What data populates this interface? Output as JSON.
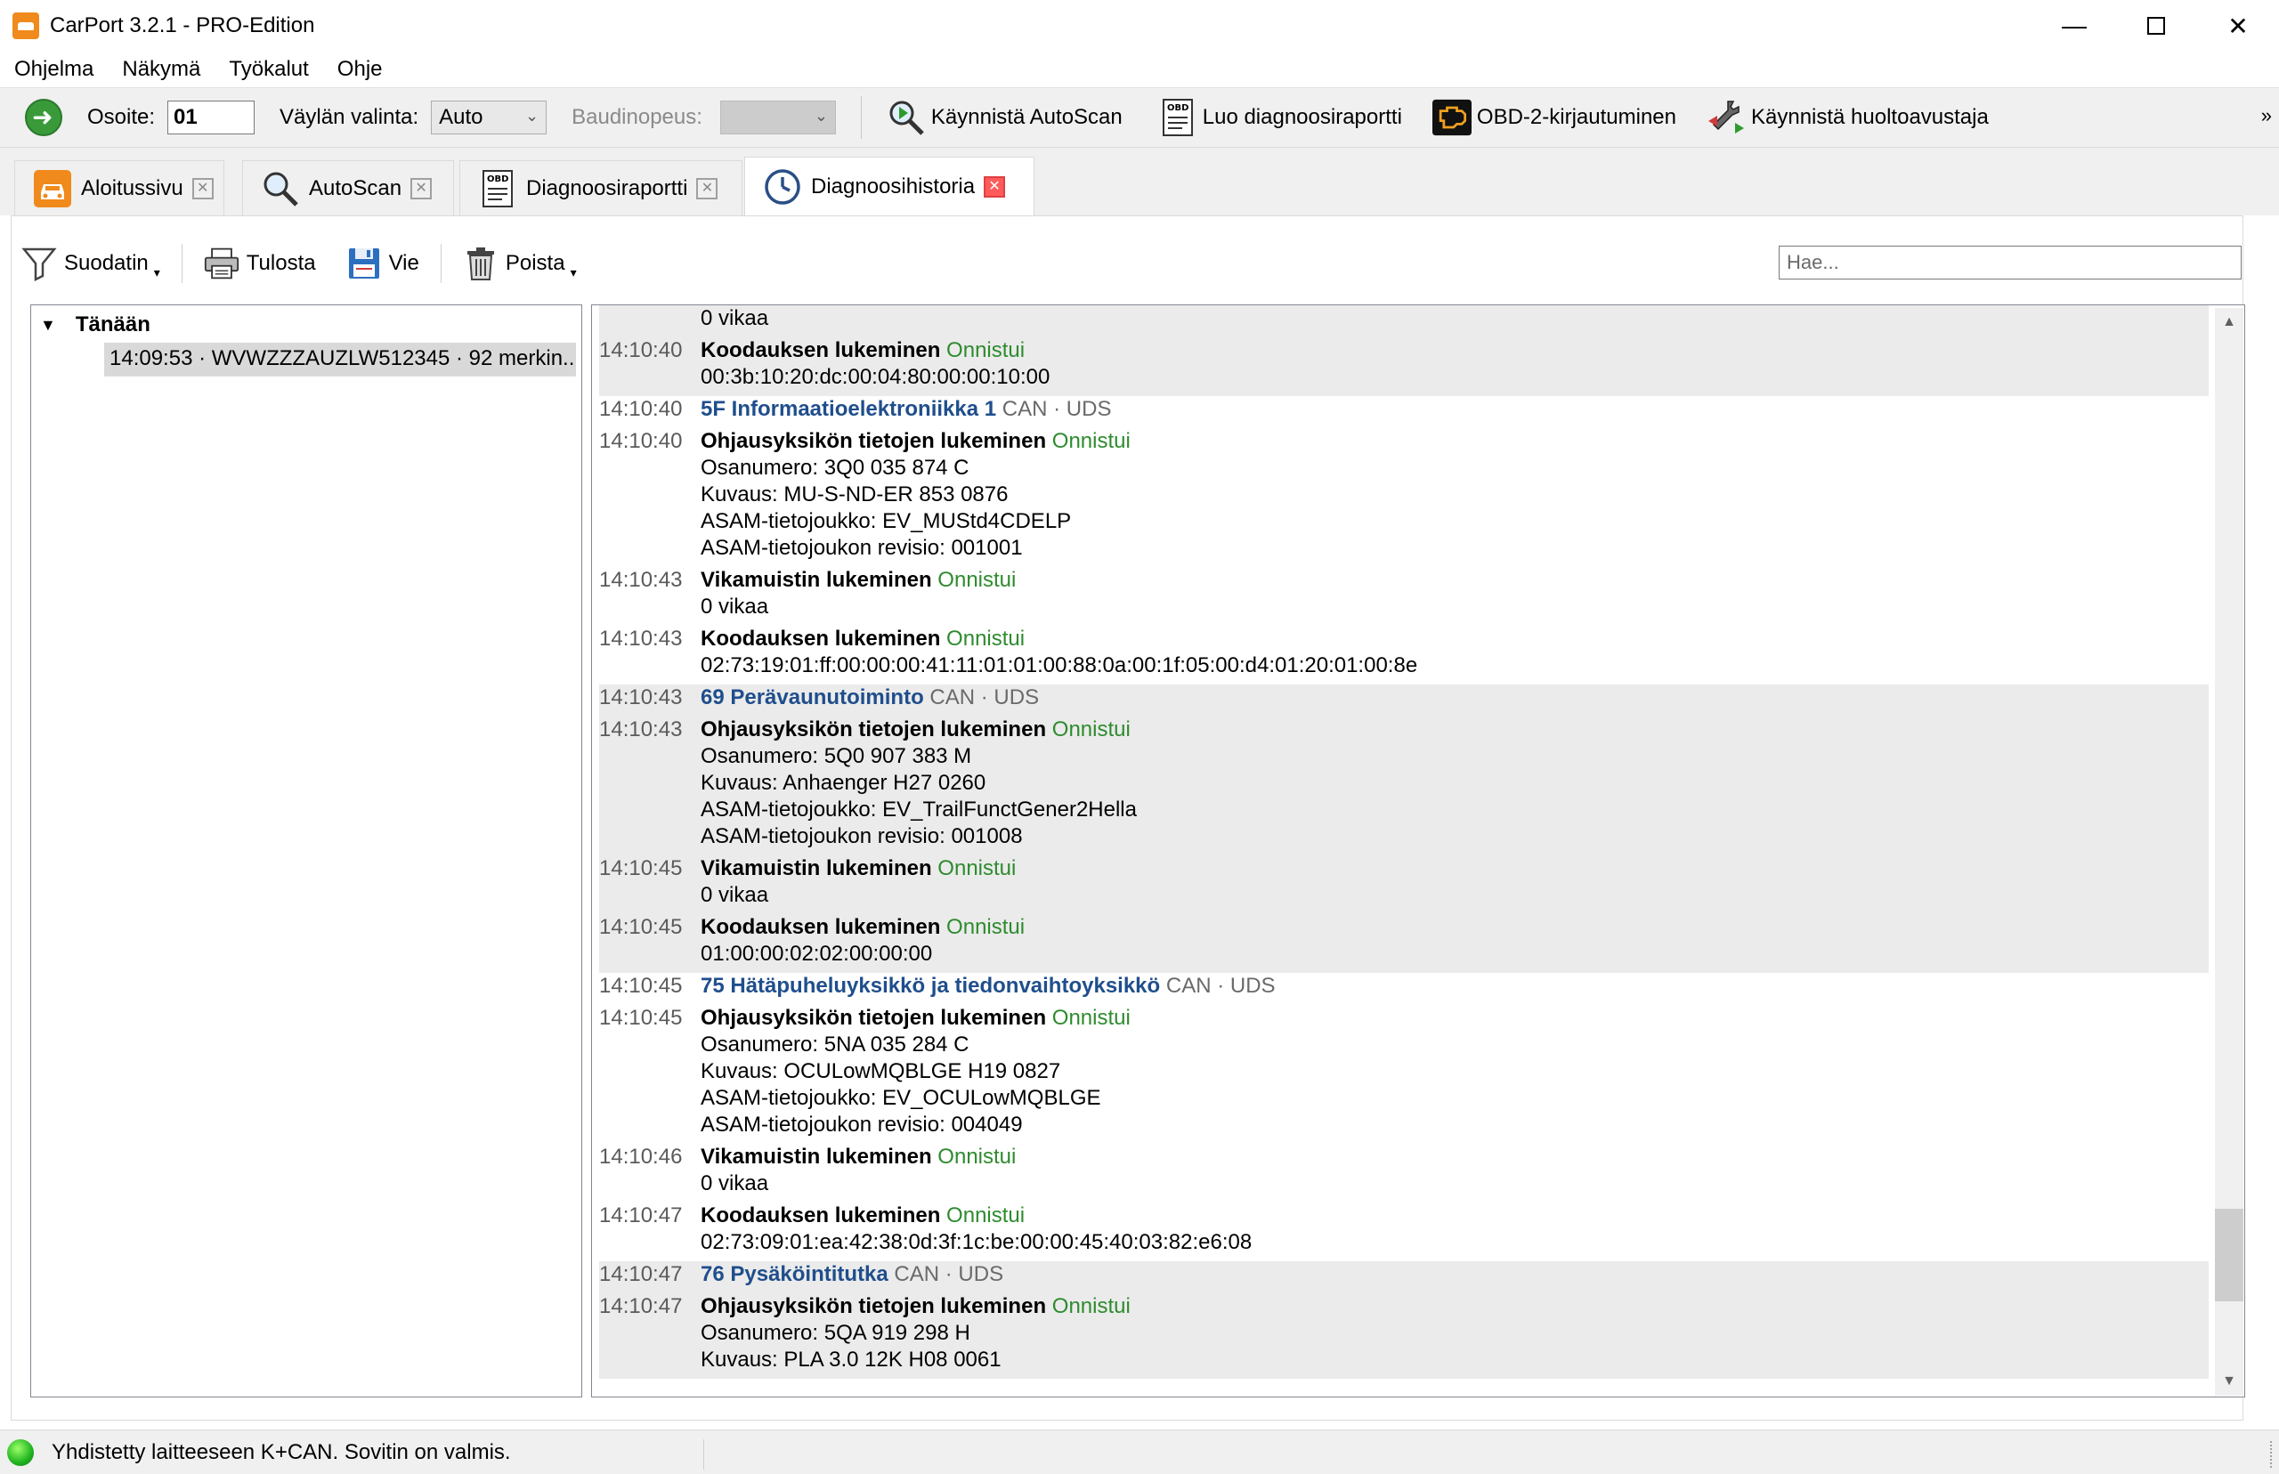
{
  "window": {
    "title": "CarPort 3.2.1 - PRO-Edition",
    "minimize": "—",
    "close": "✕"
  },
  "menu": [
    "Ohjelma",
    "Näkymä",
    "Työkalut",
    "Ohje"
  ],
  "toolbar": {
    "address_label": "Osoite:",
    "address_value": "01",
    "bus_label": "Väylän valinta:",
    "bus_value": "Auto",
    "baud_label": "Baudinopeus:",
    "baud_value": "",
    "autoscan": "Käynnistä AutoScan",
    "report": "Luo diagnoosiraportti",
    "obd_login": "OBD-2-kirjautuminen",
    "service": "Käynnistä huoltoavustaja",
    "overflow": "»"
  },
  "tabs": [
    {
      "label": "Aloitussivu"
    },
    {
      "label": "AutoScan"
    },
    {
      "label": "Diagnoosiraportti"
    },
    {
      "label": "Diagnoosihistoria"
    }
  ],
  "subtoolbar": {
    "filter": "Suodatin",
    "print": "Tulosta",
    "export": "Vie",
    "delete": "Poista",
    "search_placeholder": "Hae..."
  },
  "tree": {
    "group": "Tänään",
    "item": "14:09:53 · WVWZZZAUZLW512345 · 92 merkin..."
  },
  "log_blocks": [
    {
      "shade": true,
      "rows": [
        {
          "time": "",
          "parts": [
            {
              "t": "0 vikaa",
              "c": ""
            }
          ]
        },
        {
          "time": "14:10:40",
          "parts": [
            {
              "t": "Koodauksen lukeminen",
              "c": "b"
            },
            {
              "t": " Onnistui",
              "c": "ok"
            }
          ]
        },
        {
          "time": "",
          "parts": [
            {
              "t": "00:3b:10:20:dc:00:04:80:00:00:10:00",
              "c": ""
            }
          ]
        }
      ]
    },
    {
      "shade": false,
      "rows": [
        {
          "time": "14:10:40",
          "parts": [
            {
              "t": "5F Informaatioelektroniikka 1",
              "c": "mod"
            },
            {
              "t": "  CAN · UDS",
              "c": "proto"
            }
          ]
        },
        {
          "time": "14:10:40",
          "parts": [
            {
              "t": "Ohjausyksikön tietojen lukeminen",
              "c": "b"
            },
            {
              "t": " Onnistui",
              "c": "ok"
            }
          ]
        },
        {
          "time": "",
          "parts": [
            {
              "t": "Osanumero: 3Q0 035 874 C",
              "c": ""
            }
          ]
        },
        {
          "time": "",
          "parts": [
            {
              "t": "Kuvaus: MU-S-ND-ER 853 0876",
              "c": ""
            }
          ]
        },
        {
          "time": "",
          "parts": [
            {
              "t": "ASAM-tietojoukko: EV_MUStd4CDELP",
              "c": ""
            }
          ]
        },
        {
          "time": "",
          "parts": [
            {
              "t": "ASAM-tietojoukon revisio: 001001",
              "c": ""
            }
          ]
        },
        {
          "time": "14:10:43",
          "parts": [
            {
              "t": "Vikamuistin lukeminen",
              "c": "b"
            },
            {
              "t": " Onnistui",
              "c": "ok"
            }
          ]
        },
        {
          "time": "",
          "parts": [
            {
              "t": "0 vikaa",
              "c": ""
            }
          ]
        },
        {
          "time": "14:10:43",
          "parts": [
            {
              "t": "Koodauksen lukeminen",
              "c": "b"
            },
            {
              "t": " Onnistui",
              "c": "ok"
            }
          ]
        },
        {
          "time": "",
          "parts": [
            {
              "t": "02:73:19:01:ff:00:00:00:41:11:01:01:00:88:0a:00:1f:05:00:d4:01:20:01:00:8e",
              "c": ""
            }
          ]
        }
      ]
    },
    {
      "shade": true,
      "rows": [
        {
          "time": "14:10:43",
          "parts": [
            {
              "t": "69 Perävaunutoiminto",
              "c": "mod"
            },
            {
              "t": "  CAN · UDS",
              "c": "proto"
            }
          ]
        },
        {
          "time": "14:10:43",
          "parts": [
            {
              "t": "Ohjausyksikön tietojen lukeminen",
              "c": "b"
            },
            {
              "t": " Onnistui",
              "c": "ok"
            }
          ]
        },
        {
          "time": "",
          "parts": [
            {
              "t": "Osanumero: 5Q0 907 383 M",
              "c": ""
            }
          ]
        },
        {
          "time": "",
          "parts": [
            {
              "t": "Kuvaus: Anhaenger H27 0260",
              "c": ""
            }
          ]
        },
        {
          "time": "",
          "parts": [
            {
              "t": "ASAM-tietojoukko: EV_TrailFunctGener2Hella",
              "c": ""
            }
          ]
        },
        {
          "time": "",
          "parts": [
            {
              "t": "ASAM-tietojoukon revisio: 001008",
              "c": ""
            }
          ]
        },
        {
          "time": "14:10:45",
          "parts": [
            {
              "t": "Vikamuistin lukeminen",
              "c": "b"
            },
            {
              "t": " Onnistui",
              "c": "ok"
            }
          ]
        },
        {
          "time": "",
          "parts": [
            {
              "t": "0 vikaa",
              "c": ""
            }
          ]
        },
        {
          "time": "14:10:45",
          "parts": [
            {
              "t": "Koodauksen lukeminen",
              "c": "b"
            },
            {
              "t": " Onnistui",
              "c": "ok"
            }
          ]
        },
        {
          "time": "",
          "parts": [
            {
              "t": "01:00:00:02:02:00:00:00",
              "c": ""
            }
          ]
        }
      ]
    },
    {
      "shade": false,
      "rows": [
        {
          "time": "14:10:45",
          "parts": [
            {
              "t": "75 Hätäpuheluyksikkö ja tiedonvaihtoyksikkö",
              "c": "mod"
            },
            {
              "t": "  CAN · UDS",
              "c": "proto"
            }
          ]
        },
        {
          "time": "14:10:45",
          "parts": [
            {
              "t": "Ohjausyksikön tietojen lukeminen",
              "c": "b"
            },
            {
              "t": " Onnistui",
              "c": "ok"
            }
          ]
        },
        {
          "time": "",
          "parts": [
            {
              "t": "Osanumero: 5NA 035 284 C",
              "c": ""
            }
          ]
        },
        {
          "time": "",
          "parts": [
            {
              "t": "Kuvaus: OCULowMQBLGE H19 0827",
              "c": ""
            }
          ]
        },
        {
          "time": "",
          "parts": [
            {
              "t": "ASAM-tietojoukko: EV_OCULowMQBLGE",
              "c": ""
            }
          ]
        },
        {
          "time": "",
          "parts": [
            {
              "t": "ASAM-tietojoukon revisio: 004049",
              "c": ""
            }
          ]
        },
        {
          "time": "14:10:46",
          "parts": [
            {
              "t": "Vikamuistin lukeminen",
              "c": "b"
            },
            {
              "t": " Onnistui",
              "c": "ok"
            }
          ]
        },
        {
          "time": "",
          "parts": [
            {
              "t": "0 vikaa",
              "c": ""
            }
          ]
        },
        {
          "time": "14:10:47",
          "parts": [
            {
              "t": "Koodauksen lukeminen",
              "c": "b"
            },
            {
              "t": " Onnistui",
              "c": "ok"
            }
          ]
        },
        {
          "time": "",
          "parts": [
            {
              "t": "02:73:09:01:ea:42:38:0d:3f:1c:be:00:00:45:40:03:82:e6:08",
              "c": ""
            }
          ]
        }
      ]
    },
    {
      "shade": true,
      "rows": [
        {
          "time": "14:10:47",
          "parts": [
            {
              "t": "76 Pysäköintitutka",
              "c": "mod"
            },
            {
              "t": "  CAN · UDS",
              "c": "proto"
            }
          ]
        },
        {
          "time": "14:10:47",
          "parts": [
            {
              "t": "Ohjausyksikön tietojen lukeminen",
              "c": "b"
            },
            {
              "t": " Onnistui",
              "c": "ok"
            }
          ]
        },
        {
          "time": "",
          "parts": [
            {
              "t": "Osanumero: 5QA 919 298 H",
              "c": ""
            }
          ]
        },
        {
          "time": "",
          "parts": [
            {
              "t": "Kuvaus: PLA 3.0 12K H08 0061",
              "c": ""
            }
          ]
        }
      ]
    }
  ],
  "scroll": {
    "position": 0.93,
    "visible_fraction": 0.05
  },
  "status": {
    "text": "Yhdistetty laitteeseen K+CAN. Sovitin on valmis.",
    "led_color": "#1fb31f"
  },
  "colors": {
    "success": "#2e8b2e",
    "module": "#1f4e8c",
    "shade": "#ebebeb",
    "brand": "#f08a1c"
  }
}
